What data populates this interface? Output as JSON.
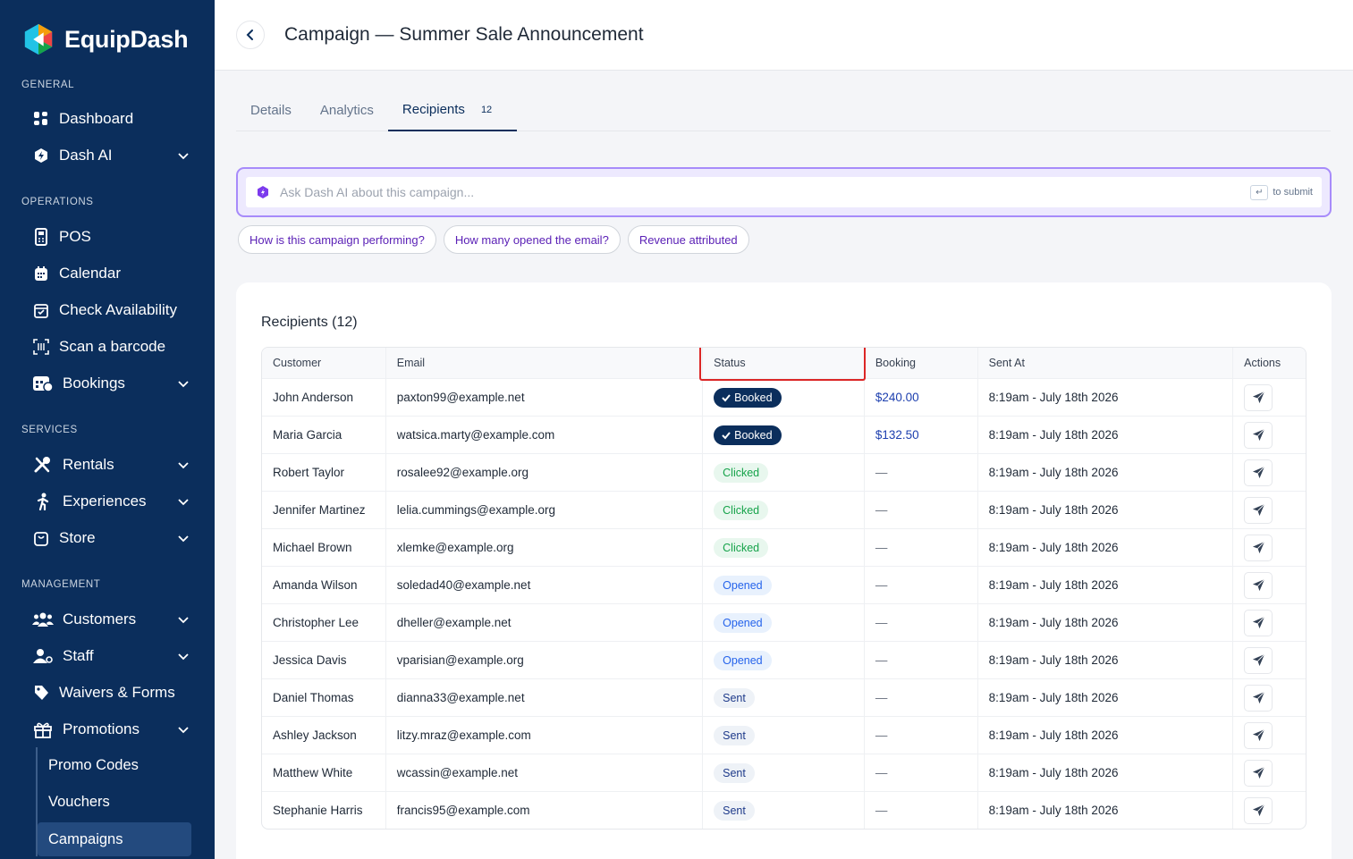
{
  "brand": {
    "name": "EquipDash"
  },
  "sidebar": {
    "sections": {
      "general": "GENERAL",
      "operations": "OPERATIONS",
      "services": "SERVICES",
      "management": "MANAGEMENT"
    },
    "items": {
      "dashboard": "Dashboard",
      "dash_ai": "Dash AI",
      "pos": "POS",
      "calendar": "Calendar",
      "check_availability": "Check Availability",
      "scan_barcode": "Scan a barcode",
      "bookings": "Bookings",
      "rentals": "Rentals",
      "experiences": "Experiences",
      "store": "Store",
      "customers": "Customers",
      "staff": "Staff",
      "waivers": "Waivers & Forms",
      "promotions": "Promotions",
      "promo_codes": "Promo Codes",
      "vouchers": "Vouchers",
      "campaigns": "Campaigns"
    }
  },
  "header": {
    "title": "Campaign — Summer Sale Announcement"
  },
  "tabs": {
    "details": "Details",
    "analytics": "Analytics",
    "recipients": "Recipients",
    "recipients_count": "12"
  },
  "ai": {
    "placeholder": "Ask Dash AI about this campaign...",
    "enter_key": "↵",
    "submit_hint": "to submit"
  },
  "chips": [
    "How is this campaign performing?",
    "How many opened the email?",
    "Revenue attributed"
  ],
  "recipients": {
    "title": "Recipients (12)",
    "columns": [
      "Customer",
      "Email",
      "Status",
      "Booking",
      "Sent At",
      "Actions"
    ],
    "rows": [
      {
        "customer": "John Anderson",
        "email": "paxton99@example.net",
        "status": "Booked",
        "booking": "$240.00",
        "sent_at": "8:19am - July 18th 2026"
      },
      {
        "customer": "Maria Garcia",
        "email": "watsica.marty@example.com",
        "status": "Booked",
        "booking": "$132.50",
        "sent_at": "8:19am - July 18th 2026"
      },
      {
        "customer": "Robert Taylor",
        "email": "rosalee92@example.org",
        "status": "Clicked",
        "booking": "—",
        "sent_at": "8:19am - July 18th 2026"
      },
      {
        "customer": "Jennifer Martinez",
        "email": "lelia.cummings@example.org",
        "status": "Clicked",
        "booking": "—",
        "sent_at": "8:19am - July 18th 2026"
      },
      {
        "customer": "Michael Brown",
        "email": "xlemke@example.org",
        "status": "Clicked",
        "booking": "—",
        "sent_at": "8:19am - July 18th 2026"
      },
      {
        "customer": "Amanda Wilson",
        "email": "soledad40@example.net",
        "status": "Opened",
        "booking": "—",
        "sent_at": "8:19am - July 18th 2026"
      },
      {
        "customer": "Christopher Lee",
        "email": "dheller@example.net",
        "status": "Opened",
        "booking": "—",
        "sent_at": "8:19am - July 18th 2026"
      },
      {
        "customer": "Jessica Davis",
        "email": "vparisian@example.org",
        "status": "Opened",
        "booking": "—",
        "sent_at": "8:19am - July 18th 2026"
      },
      {
        "customer": "Daniel Thomas",
        "email": "dianna33@example.net",
        "status": "Sent",
        "booking": "—",
        "sent_at": "8:19am - July 18th 2026"
      },
      {
        "customer": "Ashley Jackson",
        "email": "litzy.mraz@example.com",
        "status": "Sent",
        "booking": "—",
        "sent_at": "8:19am - July 18th 2026"
      },
      {
        "customer": "Matthew White",
        "email": "wcassin@example.net",
        "status": "Sent",
        "booking": "—",
        "sent_at": "8:19am - July 18th 2026"
      },
      {
        "customer": "Stephanie Harris",
        "email": "francis95@example.com",
        "status": "Sent",
        "booking": "—",
        "sent_at": "8:19am - July 18th 2026"
      }
    ]
  },
  "colors": {
    "sidebar_bg": "#0b2e5c",
    "ai_border": "#a78bfa",
    "highlight": "#dc2626",
    "booked": "#0b2e5c",
    "clicked": "#16a34a",
    "opened": "#2563eb"
  },
  "icons": {
    "back": "chevron-left-icon",
    "action": "send-icon"
  }
}
